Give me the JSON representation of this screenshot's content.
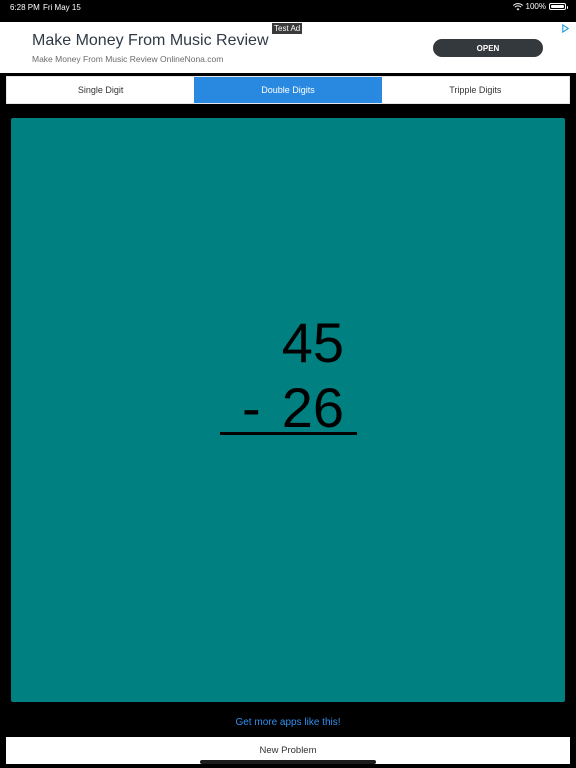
{
  "status_bar": {
    "time": "6:28 PM",
    "date": "Fri May 15",
    "battery_text": "100%",
    "battery_level": 1.0,
    "icons": [
      "wifi-icon",
      "battery-icon"
    ]
  },
  "ad": {
    "label": "Test Ad",
    "title": "Make Money From Music Review",
    "subtitle": "Make Money From Music Review OnlineNona.com",
    "cta": "OPEN",
    "choices_icon": "ad-choices-icon"
  },
  "tabs": [
    {
      "label": "Single Digit",
      "active": false
    },
    {
      "label": "Double Digits",
      "active": true
    },
    {
      "label": "Tripple Digits",
      "active": false
    }
  ],
  "problem": {
    "top_number": "45",
    "operator": "-",
    "bottom_number": "26"
  },
  "more_apps_link": "Get more apps like this!",
  "new_problem_button": "New Problem",
  "colors": {
    "background": "#000000",
    "card": "#008080",
    "accent": "#2989e0",
    "link": "#2f8ff0"
  }
}
